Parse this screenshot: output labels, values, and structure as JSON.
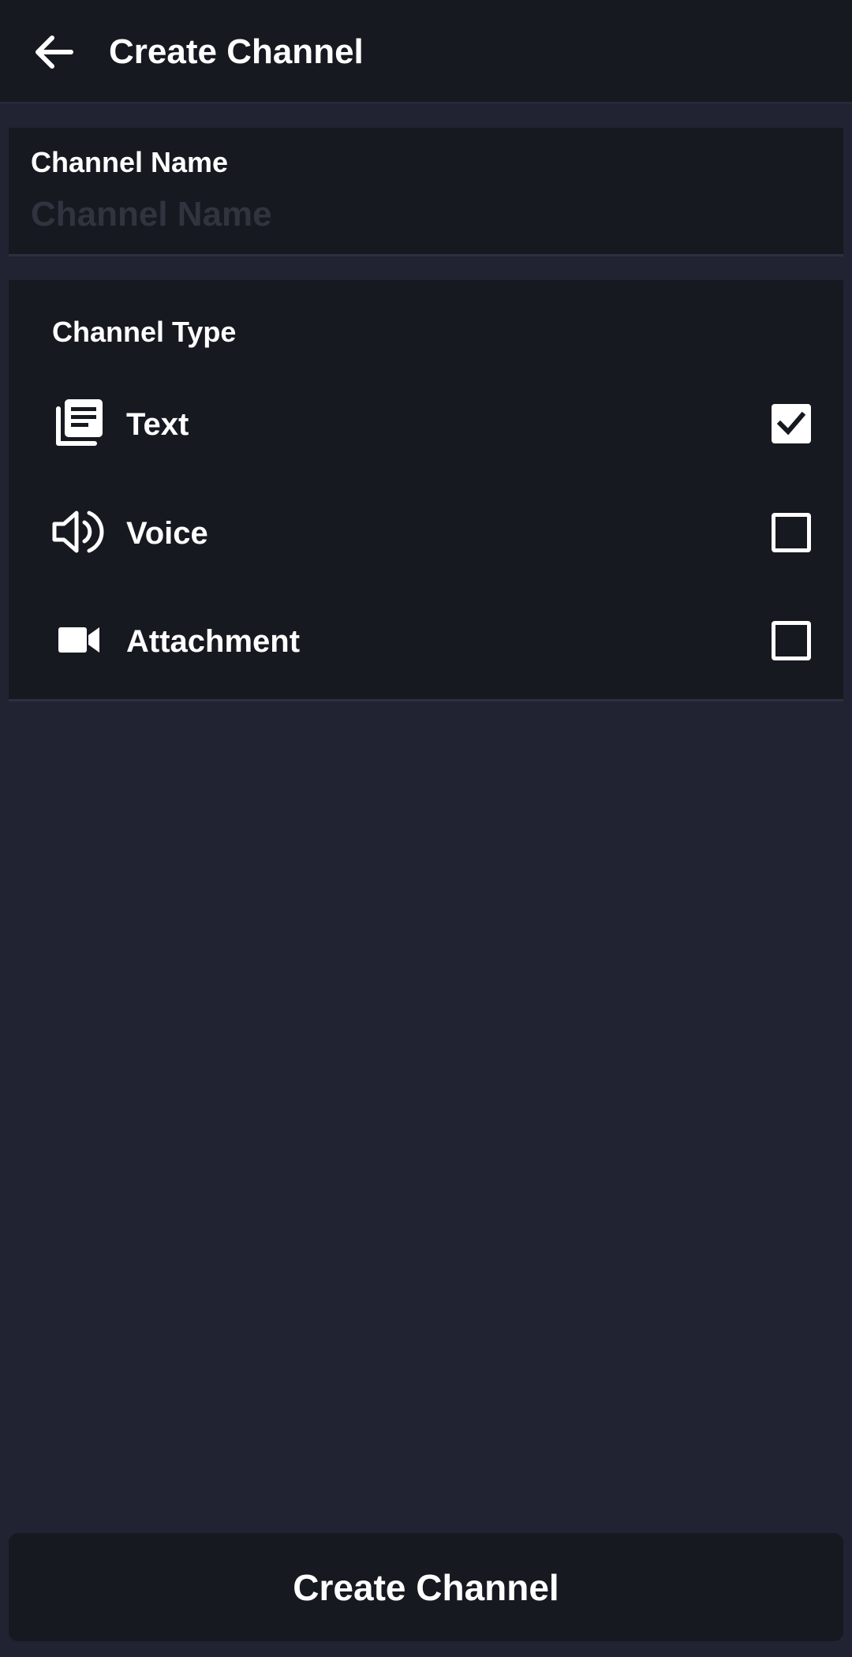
{
  "header": {
    "back_icon": "arrow-left-icon",
    "title": "Create Channel"
  },
  "channel_name": {
    "label": "Channel Name",
    "value": "",
    "placeholder": "Channel Name"
  },
  "channel_type": {
    "label": "Channel Type",
    "options": [
      {
        "label": "Text",
        "icon": "text-document-icon",
        "checked": true
      },
      {
        "label": "Voice",
        "icon": "speaker-icon",
        "checked": false
      },
      {
        "label": "Attachment",
        "icon": "video-camera-icon",
        "checked": false
      }
    ]
  },
  "footer": {
    "create_button_label": "Create Channel"
  },
  "colors": {
    "background": "#212332",
    "surface": "#161920",
    "text": "#ffffff",
    "placeholder": "#31343f"
  }
}
